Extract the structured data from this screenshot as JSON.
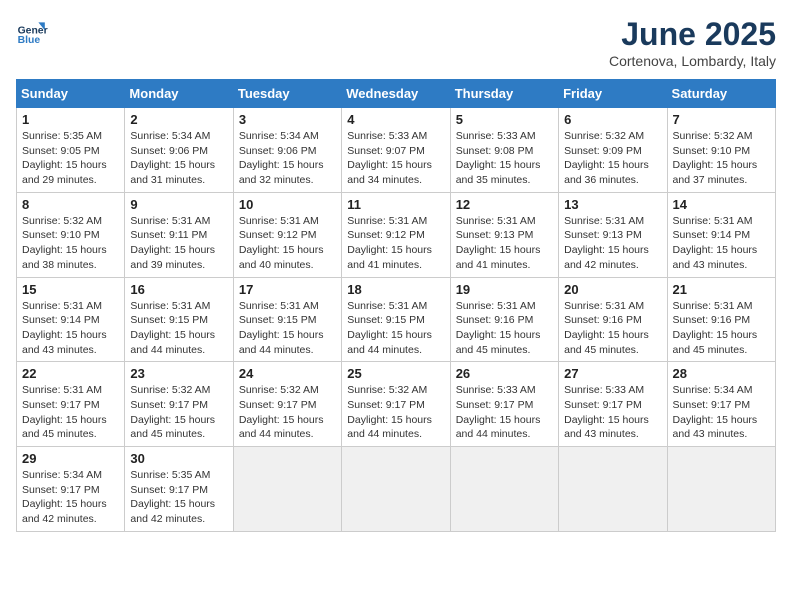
{
  "header": {
    "logo_line1": "General",
    "logo_line2": "Blue",
    "month": "June 2025",
    "location": "Cortenova, Lombardy, Italy"
  },
  "columns": [
    "Sunday",
    "Monday",
    "Tuesday",
    "Wednesday",
    "Thursday",
    "Friday",
    "Saturday"
  ],
  "weeks": [
    [
      {
        "num": "1",
        "lines": [
          "Sunrise: 5:35 AM",
          "Sunset: 9:05 PM",
          "Daylight: 15 hours",
          "and 29 minutes."
        ]
      },
      {
        "num": "2",
        "lines": [
          "Sunrise: 5:34 AM",
          "Sunset: 9:06 PM",
          "Daylight: 15 hours",
          "and 31 minutes."
        ]
      },
      {
        "num": "3",
        "lines": [
          "Sunrise: 5:34 AM",
          "Sunset: 9:06 PM",
          "Daylight: 15 hours",
          "and 32 minutes."
        ]
      },
      {
        "num": "4",
        "lines": [
          "Sunrise: 5:33 AM",
          "Sunset: 9:07 PM",
          "Daylight: 15 hours",
          "and 34 minutes."
        ]
      },
      {
        "num": "5",
        "lines": [
          "Sunrise: 5:33 AM",
          "Sunset: 9:08 PM",
          "Daylight: 15 hours",
          "and 35 minutes."
        ]
      },
      {
        "num": "6",
        "lines": [
          "Sunrise: 5:32 AM",
          "Sunset: 9:09 PM",
          "Daylight: 15 hours",
          "and 36 minutes."
        ]
      },
      {
        "num": "7",
        "lines": [
          "Sunrise: 5:32 AM",
          "Sunset: 9:10 PM",
          "Daylight: 15 hours",
          "and 37 minutes."
        ]
      }
    ],
    [
      {
        "num": "8",
        "lines": [
          "Sunrise: 5:32 AM",
          "Sunset: 9:10 PM",
          "Daylight: 15 hours",
          "and 38 minutes."
        ]
      },
      {
        "num": "9",
        "lines": [
          "Sunrise: 5:31 AM",
          "Sunset: 9:11 PM",
          "Daylight: 15 hours",
          "and 39 minutes."
        ]
      },
      {
        "num": "10",
        "lines": [
          "Sunrise: 5:31 AM",
          "Sunset: 9:12 PM",
          "Daylight: 15 hours",
          "and 40 minutes."
        ]
      },
      {
        "num": "11",
        "lines": [
          "Sunrise: 5:31 AM",
          "Sunset: 9:12 PM",
          "Daylight: 15 hours",
          "and 41 minutes."
        ]
      },
      {
        "num": "12",
        "lines": [
          "Sunrise: 5:31 AM",
          "Sunset: 9:13 PM",
          "Daylight: 15 hours",
          "and 41 minutes."
        ]
      },
      {
        "num": "13",
        "lines": [
          "Sunrise: 5:31 AM",
          "Sunset: 9:13 PM",
          "Daylight: 15 hours",
          "and 42 minutes."
        ]
      },
      {
        "num": "14",
        "lines": [
          "Sunrise: 5:31 AM",
          "Sunset: 9:14 PM",
          "Daylight: 15 hours",
          "and 43 minutes."
        ]
      }
    ],
    [
      {
        "num": "15",
        "lines": [
          "Sunrise: 5:31 AM",
          "Sunset: 9:14 PM",
          "Daylight: 15 hours",
          "and 43 minutes."
        ]
      },
      {
        "num": "16",
        "lines": [
          "Sunrise: 5:31 AM",
          "Sunset: 9:15 PM",
          "Daylight: 15 hours",
          "and 44 minutes."
        ]
      },
      {
        "num": "17",
        "lines": [
          "Sunrise: 5:31 AM",
          "Sunset: 9:15 PM",
          "Daylight: 15 hours",
          "and 44 minutes."
        ]
      },
      {
        "num": "18",
        "lines": [
          "Sunrise: 5:31 AM",
          "Sunset: 9:15 PM",
          "Daylight: 15 hours",
          "and 44 minutes."
        ]
      },
      {
        "num": "19",
        "lines": [
          "Sunrise: 5:31 AM",
          "Sunset: 9:16 PM",
          "Daylight: 15 hours",
          "and 45 minutes."
        ]
      },
      {
        "num": "20",
        "lines": [
          "Sunrise: 5:31 AM",
          "Sunset: 9:16 PM",
          "Daylight: 15 hours",
          "and 45 minutes."
        ]
      },
      {
        "num": "21",
        "lines": [
          "Sunrise: 5:31 AM",
          "Sunset: 9:16 PM",
          "Daylight: 15 hours",
          "and 45 minutes."
        ]
      }
    ],
    [
      {
        "num": "22",
        "lines": [
          "Sunrise: 5:31 AM",
          "Sunset: 9:17 PM",
          "Daylight: 15 hours",
          "and 45 minutes."
        ]
      },
      {
        "num": "23",
        "lines": [
          "Sunrise: 5:32 AM",
          "Sunset: 9:17 PM",
          "Daylight: 15 hours",
          "and 45 minutes."
        ]
      },
      {
        "num": "24",
        "lines": [
          "Sunrise: 5:32 AM",
          "Sunset: 9:17 PM",
          "Daylight: 15 hours",
          "and 44 minutes."
        ]
      },
      {
        "num": "25",
        "lines": [
          "Sunrise: 5:32 AM",
          "Sunset: 9:17 PM",
          "Daylight: 15 hours",
          "and 44 minutes."
        ]
      },
      {
        "num": "26",
        "lines": [
          "Sunrise: 5:33 AM",
          "Sunset: 9:17 PM",
          "Daylight: 15 hours",
          "and 44 minutes."
        ]
      },
      {
        "num": "27",
        "lines": [
          "Sunrise: 5:33 AM",
          "Sunset: 9:17 PM",
          "Daylight: 15 hours",
          "and 43 minutes."
        ]
      },
      {
        "num": "28",
        "lines": [
          "Sunrise: 5:34 AM",
          "Sunset: 9:17 PM",
          "Daylight: 15 hours",
          "and 43 minutes."
        ]
      }
    ],
    [
      {
        "num": "29",
        "lines": [
          "Sunrise: 5:34 AM",
          "Sunset: 9:17 PM",
          "Daylight: 15 hours",
          "and 42 minutes."
        ]
      },
      {
        "num": "30",
        "lines": [
          "Sunrise: 5:35 AM",
          "Sunset: 9:17 PM",
          "Daylight: 15 hours",
          "and 42 minutes."
        ]
      },
      null,
      null,
      null,
      null,
      null
    ]
  ]
}
